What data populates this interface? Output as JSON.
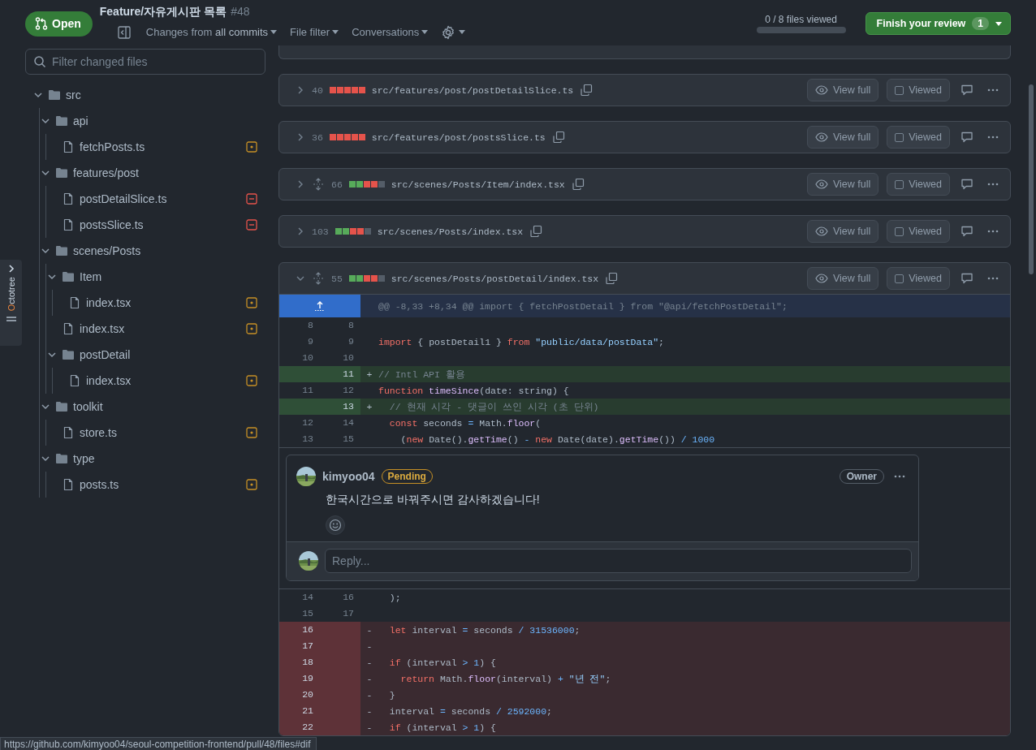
{
  "header": {
    "state": {
      "label": "Open",
      "kind": "open"
    },
    "title": "Feature/자유게시판 목록",
    "number": "#48",
    "menus": [
      "Changes from **all commits**",
      "File filter",
      "Conversations"
    ],
    "progress": {
      "label": "0 / 8 files viewed",
      "level": 0
    },
    "finish_button": {
      "label": "Finish your review",
      "count": "1"
    }
  },
  "octotree": {
    "label": "Octotree"
  },
  "sidebar": {
    "filter": {
      "placeholder": "Filter changed files"
    },
    "tree": [
      {
        "kind": "folder",
        "name": "src",
        "expanded": true,
        "children": [
          {
            "kind": "folder",
            "name": "api",
            "expanded": true,
            "children": [
              {
                "kind": "modified",
                "name": "fetchPosts.ts"
              }
            ]
          },
          {
            "kind": "folder",
            "name": "features/post",
            "expanded": true,
            "children": [
              {
                "kind": "removed",
                "name": "postDetailSlice.ts"
              },
              {
                "kind": "removed",
                "name": "postsSlice.ts"
              }
            ]
          },
          {
            "kind": "folder",
            "name": "scenes/Posts",
            "expanded": true,
            "children": [
              {
                "kind": "folder",
                "name": "Item",
                "expanded": true,
                "children": [
                  {
                    "kind": "modified",
                    "name": "index.tsx"
                  }
                ]
              },
              {
                "kind": "modified",
                "name": "index.tsx"
              },
              {
                "kind": "folder",
                "name": "postDetail",
                "expanded": true,
                "children": [
                  {
                    "kind": "modified",
                    "name": "index.tsx"
                  }
                ]
              }
            ]
          },
          {
            "kind": "folder",
            "name": "toolkit",
            "expanded": true,
            "children": [
              {
                "kind": "modified",
                "name": "store.ts"
              }
            ]
          },
          {
            "kind": "folder",
            "name": "type",
            "expanded": true,
            "children": [
              {
                "kind": "modified",
                "name": "posts.ts"
              }
            ]
          }
        ]
      }
    ]
  },
  "files": [
    {
      "changes": "40",
      "expanded": false,
      "expandable": false,
      "diffstat": [
        {
          "color": "#e5534b"
        },
        {
          "color": "#e5534b"
        },
        {
          "color": "#e5534b"
        },
        {
          "color": "#e5534b"
        },
        {
          "color": "#e5534b"
        }
      ],
      "path": "src/features/post/postDetailSlice.ts",
      "view_full": "View full",
      "viewed": {
        "label": "Viewed",
        "checked": false
      }
    },
    {
      "changes": "36",
      "expanded": false,
      "expandable": false,
      "diffstat": [
        {
          "color": "#e5534b"
        },
        {
          "color": "#e5534b"
        },
        {
          "color": "#e5534b"
        },
        {
          "color": "#e5534b"
        },
        {
          "color": "#e5534b"
        }
      ],
      "path": "src/features/post/postsSlice.ts",
      "view_full": "View full",
      "viewed": {
        "label": "Viewed",
        "checked": false
      }
    },
    {
      "changes": "66",
      "expanded": false,
      "expandable": true,
      "diffstat": [
        {
          "color": "#57ab5a"
        },
        {
          "color": "#57ab5a"
        },
        {
          "color": "#e5534b"
        },
        {
          "color": "#e5534b"
        },
        {
          "color": "#545d68"
        }
      ],
      "path": "src/scenes/Posts/Item/index.tsx",
      "view_full": "View full",
      "viewed": {
        "label": "Viewed",
        "checked": false
      }
    },
    {
      "changes": "103",
      "expanded": false,
      "expandable": false,
      "diffstat": [
        {
          "color": "#57ab5a"
        },
        {
          "color": "#57ab5a"
        },
        {
          "color": "#e5534b"
        },
        {
          "color": "#e5534b"
        },
        {
          "color": "#545d68"
        }
      ],
      "path": "src/scenes/Posts/index.tsx",
      "view_full": "View full",
      "viewed": {
        "label": "Viewed",
        "checked": false
      }
    },
    {
      "changes": "55",
      "expanded": true,
      "expandable": true,
      "diffstat": [
        {
          "color": "#57ab5a"
        },
        {
          "color": "#57ab5a"
        },
        {
          "color": "#e5534b"
        },
        {
          "color": "#e5534b"
        },
        {
          "color": "#545d68"
        }
      ],
      "path": "src/scenes/Posts/postDetail/index.tsx",
      "view_full": "View full",
      "viewed": {
        "label": "Viewed",
        "checked": false
      },
      "lines": [
        {
          "kind": "hunk",
          "text": "@@ -8,33 +8,34 @@ import { fetchPostDetail } from \"@api/fetchPostDetail\";"
        },
        {
          "kind": "context",
          "old": "8",
          "new": "8"
        },
        {
          "kind": "context",
          "old": "9",
          "new": "9",
          "code": [
            {
              "text": "import",
              "kind": "keyword"
            },
            {
              "text": " { postDetail1 } ",
              "kind": "plain"
            },
            {
              "text": "from",
              "kind": "keyword"
            },
            {
              "text": " \"public/data/postData\"",
              "kind": "string"
            },
            {
              "text": ";",
              "kind": "plain"
            }
          ]
        },
        {
          "kind": "context",
          "old": "10",
          "new": "10"
        },
        {
          "kind": "added",
          "new": "11",
          "sign": "+",
          "code": [
            {
              "text": "// Intl API 활용",
              "kind": "comment"
            }
          ]
        },
        {
          "kind": "context",
          "old": "11",
          "new": "12",
          "code": [
            {
              "text": "function",
              "kind": "keyword"
            },
            {
              "text": " timeSince",
              "kind": "function"
            },
            {
              "text": "(date: string) {",
              "kind": "plain"
            }
          ]
        },
        {
          "kind": "added",
          "new": "13",
          "sign": "+",
          "code": [
            {
              "text": "  // 현재 시각 - 댓글이 쓰인 시각 (초 단위)",
              "kind": "comment"
            }
          ]
        },
        {
          "kind": "context",
          "old": "12",
          "new": "14",
          "code": [
            {
              "text": "  const",
              "kind": "keyword"
            },
            {
              "text": " seconds ",
              "kind": "plain"
            },
            {
              "text": "=",
              "kind": "operator"
            },
            {
              "text": " Math.",
              "kind": "plain"
            },
            {
              "text": "floor",
              "kind": "function"
            },
            {
              "text": "(",
              "kind": "plain"
            }
          ]
        },
        {
          "kind": "context",
          "old": "13",
          "new": "15",
          "code": [
            {
              "text": "    (",
              "kind": "plain"
            },
            {
              "text": "new",
              "kind": "keyword"
            },
            {
              "text": " Date().",
              "kind": "plain"
            },
            {
              "text": "getTime",
              "kind": "function"
            },
            {
              "text": "() ",
              "kind": "plain"
            },
            {
              "text": "-",
              "kind": "operator"
            },
            {
              "text": " new",
              "kind": "keyword"
            },
            {
              "text": " Date(date).",
              "kind": "plain"
            },
            {
              "text": "getTime",
              "kind": "function"
            },
            {
              "text": "()) ",
              "kind": "plain"
            },
            {
              "text": "/ 1000",
              "kind": "number"
            }
          ]
        },
        {
          "kind": "comment",
          "author": "kimyoo04",
          "badge": "Pending",
          "role": "Owner",
          "body": "한국시간으로 바꿔주시면 감사하겠습니다!",
          "reply_placeholder": "Reply..."
        },
        {
          "kind": "context",
          "old": "14",
          "new": "16",
          "code": [
            {
              "text": "  );",
              "kind": "plain"
            }
          ]
        },
        {
          "kind": "context",
          "old": "15",
          "new": "17"
        },
        {
          "kind": "removed",
          "old": "16",
          "sign": "-",
          "code": [
            {
              "text": "  let",
              "kind": "keyword"
            },
            {
              "text": " interval ",
              "kind": "plain"
            },
            {
              "text": "=",
              "kind": "operator"
            },
            {
              "text": " seconds ",
              "kind": "plain"
            },
            {
              "text": "/ 31536000",
              "kind": "number"
            },
            {
              "text": ";",
              "kind": "plain"
            }
          ]
        },
        {
          "kind": "removed",
          "old": "17",
          "sign": "-"
        },
        {
          "kind": "removed",
          "old": "18",
          "sign": "-",
          "code": [
            {
              "text": "  if",
              "kind": "keyword"
            },
            {
              "text": " (interval ",
              "kind": "plain"
            },
            {
              "text": "> 1",
              "kind": "number"
            },
            {
              "text": ") {",
              "kind": "plain"
            }
          ]
        },
        {
          "kind": "removed",
          "old": "19",
          "sign": "-",
          "code": [
            {
              "text": "    return",
              "kind": "keyword"
            },
            {
              "text": " Math.",
              "kind": "plain"
            },
            {
              "text": "floor",
              "kind": "function"
            },
            {
              "text": "(interval) ",
              "kind": "plain"
            },
            {
              "text": "+",
              "kind": "operator"
            },
            {
              "text": " \"년 전\"",
              "kind": "string"
            },
            {
              "text": ";",
              "kind": "plain"
            }
          ]
        },
        {
          "kind": "removed",
          "old": "20",
          "sign": "-",
          "code": [
            {
              "text": "  }",
              "kind": "plain"
            }
          ]
        },
        {
          "kind": "removed",
          "old": "21",
          "sign": "-",
          "code": [
            {
              "text": "  interval ",
              "kind": "plain"
            },
            {
              "text": "=",
              "kind": "operator"
            },
            {
              "text": " seconds ",
              "kind": "plain"
            },
            {
              "text": "/ 2592000",
              "kind": "number"
            },
            {
              "text": ";",
              "kind": "plain"
            }
          ]
        },
        {
          "kind": "removed",
          "old": "22",
          "sign": "-",
          "code": [
            {
              "text": "  if",
              "kind": "keyword"
            },
            {
              "text": " (interval ",
              "kind": "plain"
            },
            {
              "text": "> 1",
              "kind": "number"
            },
            {
              "text": ") {",
              "kind": "plain"
            }
          ]
        }
      ]
    }
  ],
  "status_url": "https://github.com/kimyoo04/seoul-competition-frontend/pull/48/files#dif"
}
